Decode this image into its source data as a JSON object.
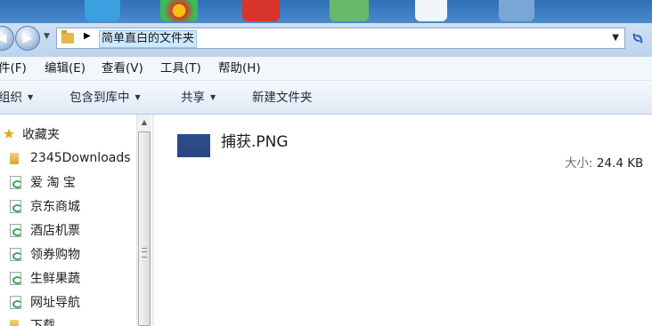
{
  "address_bar": {
    "path": "简单直白的文件夹"
  },
  "menu": {
    "items": [
      "件(F)",
      "编辑(E)",
      "查看(V)",
      "工具(T)",
      "帮助(H)"
    ]
  },
  "command_bar": {
    "organize": "组织",
    "include_in_library": "包含到库中",
    "share": "共享",
    "new_folder": "新建文件夹"
  },
  "nav_pane": {
    "favorites": "收藏夹",
    "items": [
      "2345Downloads",
      "爱 淘 宝",
      "京东商城",
      "酒店机票",
      "领券购物",
      "生鲜果蔬",
      "网址导航",
      "下载"
    ]
  },
  "file": {
    "name": "捕获.PNG",
    "size_label": "大小:",
    "size_value": "24.4 KB",
    "thumbnail_color": "#2a4a88"
  },
  "colors": {
    "accent": "#2f6fb8",
    "selection": "#cde8ff"
  }
}
